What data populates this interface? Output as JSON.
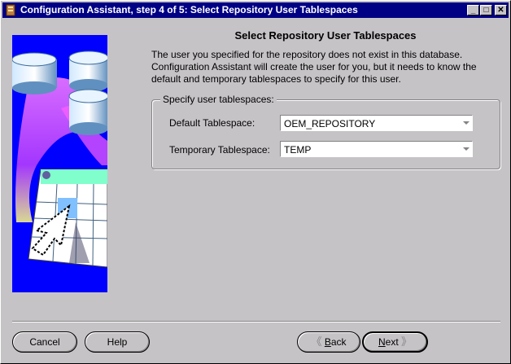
{
  "window": {
    "title": "Configuration Assistant, step 4 of 5: Select Repository User Tablespaces",
    "controls": {
      "minimize": "_",
      "maximize": "□",
      "close": "✕"
    }
  },
  "main": {
    "heading": "Select Repository User Tablespaces",
    "description": [
      "The user you specified for the repository does not exist in this database.",
      "Configuration Assistant will create the user for you, but it needs to know the",
      "default and temporary tablespaces to specify for this user."
    ],
    "group_label": "Specify user tablespaces:",
    "fields": {
      "default_label": "Default Tablespace:",
      "default_value": "OEM_REPOSITORY",
      "temporary_label": "Temporary Tablespace:",
      "temporary_value": "TEMP"
    }
  },
  "buttons": {
    "cancel": "Cancel",
    "help": "Help",
    "back_mnemonic": "B",
    "back_rest": "ack",
    "next_mnemonic": "N",
    "next_rest": "ext",
    "back_chevron": "《",
    "next_chevron": "》"
  }
}
